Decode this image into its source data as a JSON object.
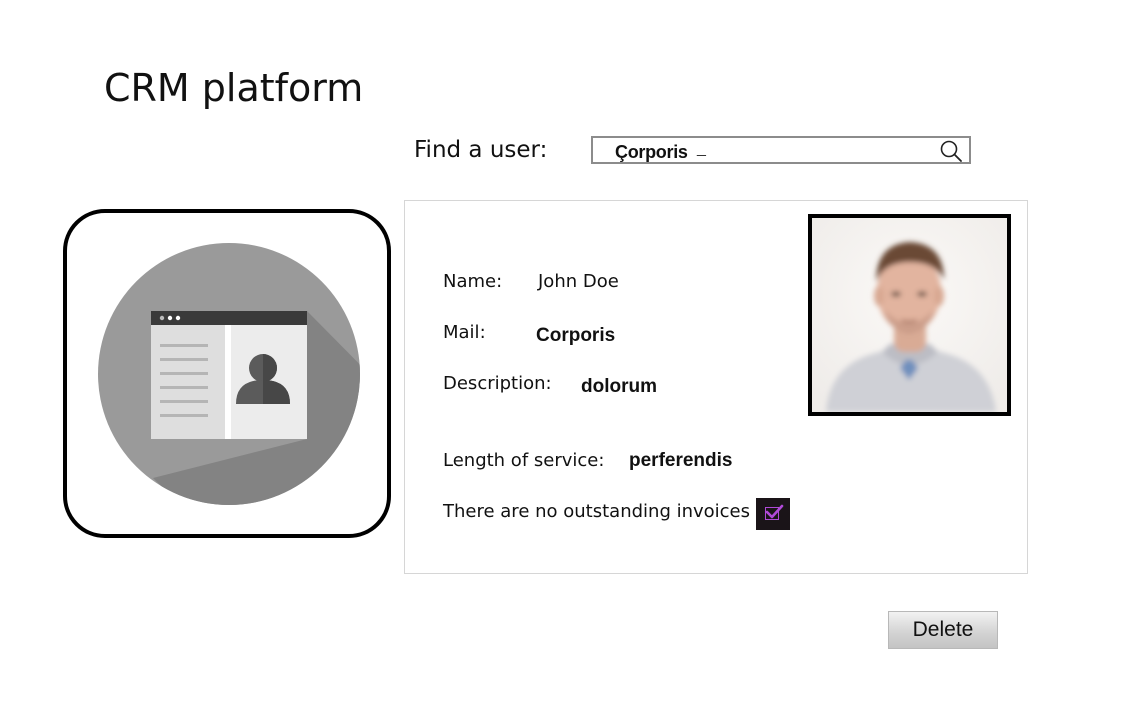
{
  "app": {
    "title": "CRM platform"
  },
  "search": {
    "label": "Find a user:",
    "value": "Çorporis",
    "caret": "_",
    "icon": "search-icon"
  },
  "app_icon": {
    "icon": "contact-card-icon",
    "colors": {
      "circle": "#9a9a9a",
      "shadow": "#838383",
      "card": "#ececec",
      "card_header": "#3a3a3a",
      "person": "#5b5b5b"
    }
  },
  "user_card": {
    "name_label": "Name:",
    "name_value": "John Doe",
    "mail_label": "Mail:",
    "mail_value": "Corporis",
    "description_label": "Description:",
    "description_value": "dolorum",
    "service_label": "Length of service:",
    "service_value": "perferendis",
    "invoices_label": "There are no outstanding invoices",
    "invoices_checked": true,
    "photo": "user-photo"
  },
  "actions": {
    "delete_label": "Delete"
  },
  "colors": {
    "checkbox_background": "#1a1418",
    "checkbox_accent": "#b04ad8"
  }
}
